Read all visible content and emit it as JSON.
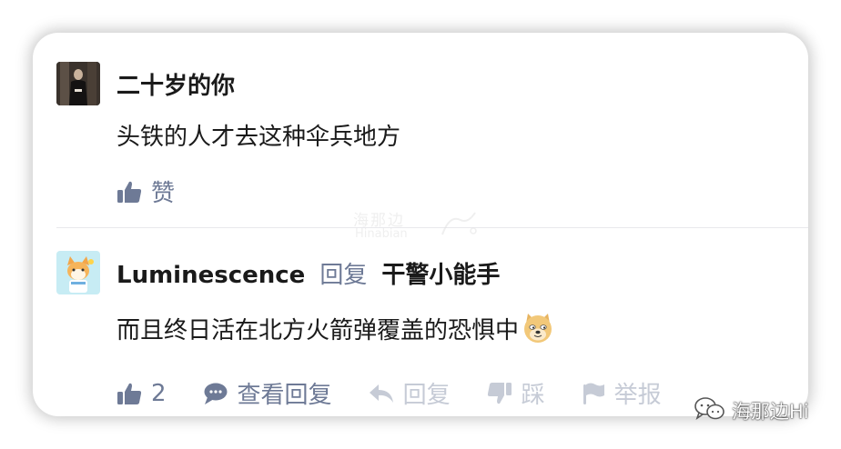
{
  "comments": [
    {
      "username": "二十岁的你",
      "text": "头铁的人才去这种伞兵地方",
      "like_label": "赞"
    },
    {
      "username": "Luminescence",
      "reply_label": "回复",
      "reply_target": "干警小能手",
      "text": "而且终日活在北方火箭弹覆盖的恐惧中",
      "like_count": "2",
      "view_replies_label": "查看回复",
      "reply_action_label": "回复",
      "dislike_label": "踩",
      "report_label": "举报"
    }
  ],
  "watermarks": {
    "center_cn": "海那边",
    "center_en": "Hinabian",
    "wechat_account": "海那边Hi"
  },
  "colors": {
    "action_active": "#6e7a96",
    "action_disabled": "#c6cbd6",
    "text": "#1a1a1a"
  },
  "icons": {
    "like": "thumbs-up-icon",
    "comment": "speech-bubble-icon",
    "reply": "reply-arrow-icon",
    "dislike": "thumbs-down-icon",
    "report": "flag-icon",
    "wechat": "wechat-icon"
  }
}
